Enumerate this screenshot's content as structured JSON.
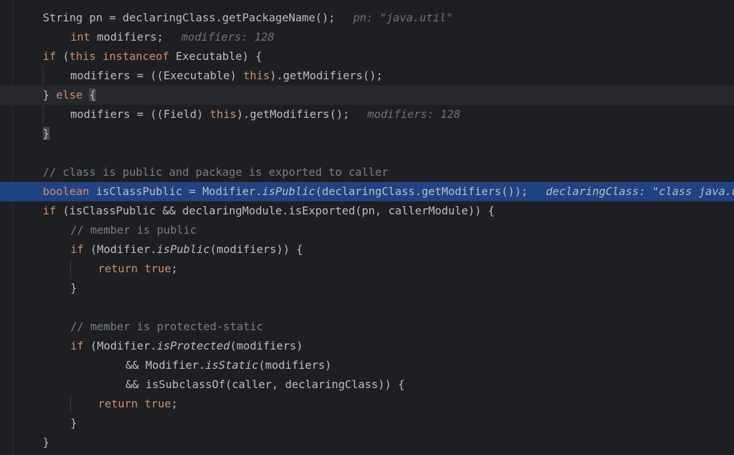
{
  "editor": {
    "language": "java",
    "highlighted_line_index": 9,
    "colors": {
      "background": "#1e1f22",
      "selection": "#214283",
      "keyword": "#cf8e6d",
      "comment": "#7a7e85",
      "text": "#bcbec4"
    },
    "lines": [
      {
        "tokens": [
          {
            "t": "String pn = declaringClass.getPackageName();",
            "c": ""
          }
        ],
        "hint": "pn: \"java.util\""
      },
      {
        "tokens": [
          {
            "t": "int",
            "c": "kw"
          },
          {
            "t": " modifiers;",
            "c": ""
          }
        ],
        "hint": "modifiers: 128"
      },
      {
        "tokens": [
          {
            "t": "if",
            "c": "kw"
          },
          {
            "t": " (",
            "c": ""
          },
          {
            "t": "this",
            "c": "kw"
          },
          {
            "t": " ",
            "c": ""
          },
          {
            "t": "instanceof",
            "c": "kw"
          },
          {
            "t": " Executable) {",
            "c": ""
          }
        ]
      },
      {
        "tokens": [
          {
            "t": "modifiers = ((Executable) ",
            "c": ""
          },
          {
            "t": "this",
            "c": "kw"
          },
          {
            "t": ").getModifiers();",
            "c": ""
          }
        ]
      },
      {
        "tokens": [
          {
            "t": "} ",
            "c": ""
          },
          {
            "t": "else",
            "c": "kw"
          },
          {
            "t": " ",
            "c": ""
          },
          {
            "t": "{",
            "c": "bm"
          }
        ]
      },
      {
        "tokens": [
          {
            "t": "modifiers = ((Field) ",
            "c": ""
          },
          {
            "t": "this",
            "c": "kw"
          },
          {
            "t": ").getModifiers();",
            "c": ""
          }
        ],
        "hint": "modifiers: 128"
      },
      {
        "tokens": [
          {
            "t": "}",
            "c": "bm"
          }
        ]
      },
      {
        "tokens": []
      },
      {
        "tokens": [
          {
            "t": "// class is public and package is exported to caller",
            "c": "cm"
          }
        ]
      },
      {
        "tokens": [
          {
            "t": "boolean",
            "c": "kw"
          },
          {
            "t": " isClassPublic = Modifier.",
            "c": ""
          },
          {
            "t": "isPublic",
            "c": "it"
          },
          {
            "t": "(declaringClass.getModifiers());",
            "c": ""
          }
        ],
        "hint": "declaringClass: \"class java.util.Collections$UnmodifiableCollection\""
      },
      {
        "tokens": [
          {
            "t": "if",
            "c": "kw"
          },
          {
            "t": " (isClassPublic && declaringModule.isExported(pn, callerModule)) {",
            "c": ""
          }
        ]
      },
      {
        "tokens": [
          {
            "t": "// member is public",
            "c": "cm"
          }
        ]
      },
      {
        "tokens": [
          {
            "t": "if",
            "c": "kw"
          },
          {
            "t": " (Modifier.",
            "c": ""
          },
          {
            "t": "isPublic",
            "c": "it"
          },
          {
            "t": "(modifiers)) {",
            "c": ""
          }
        ]
      },
      {
        "tokens": [
          {
            "t": "return",
            "c": "kw"
          },
          {
            "t": " ",
            "c": ""
          },
          {
            "t": "true",
            "c": "kw"
          },
          {
            "t": ";",
            "c": ""
          }
        ]
      },
      {
        "tokens": [
          {
            "t": "}",
            "c": ""
          }
        ]
      },
      {
        "tokens": []
      },
      {
        "tokens": [
          {
            "t": "// member is protected-static",
            "c": "cm"
          }
        ]
      },
      {
        "tokens": [
          {
            "t": "if",
            "c": "kw"
          },
          {
            "t": " (Modifier.",
            "c": ""
          },
          {
            "t": "isProtected",
            "c": "it"
          },
          {
            "t": "(modifiers)",
            "c": ""
          }
        ]
      },
      {
        "tokens": [
          {
            "t": "&& Modifier.",
            "c": ""
          },
          {
            "t": "isStatic",
            "c": "it"
          },
          {
            "t": "(modifiers)",
            "c": ""
          }
        ]
      },
      {
        "tokens": [
          {
            "t": "&& isSubclassOf(caller, declaringClass)) {",
            "c": ""
          }
        ]
      },
      {
        "tokens": [
          {
            "t": "return",
            "c": "kw"
          },
          {
            "t": " ",
            "c": ""
          },
          {
            "t": "true",
            "c": "kw"
          },
          {
            "t": ";",
            "c": ""
          }
        ]
      },
      {
        "tokens": [
          {
            "t": "}",
            "c": ""
          }
        ]
      },
      {
        "tokens": [
          {
            "t": "}",
            "c": ""
          }
        ]
      }
    ]
  }
}
